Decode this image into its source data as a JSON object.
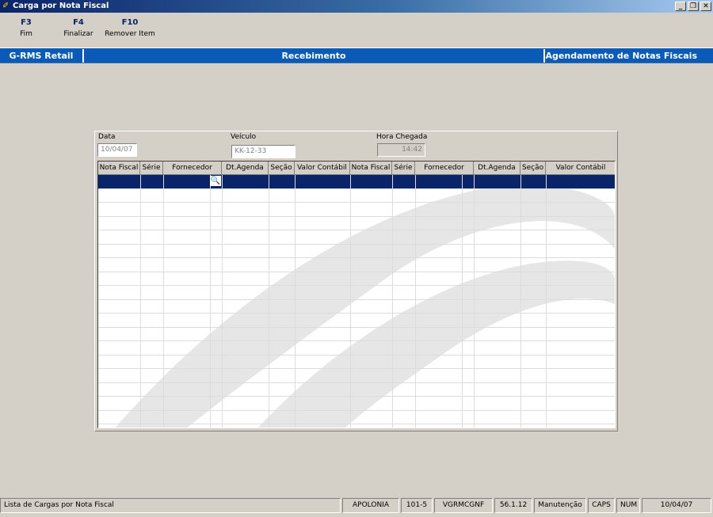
{
  "window": {
    "title": "Carga por Nota Fiscal",
    "icon": "app-icon"
  },
  "fkeys": [
    {
      "key": "F3",
      "label": "Fim"
    },
    {
      "key": "F4",
      "label": "Finalizar"
    },
    {
      "key": "F10",
      "label": "Remover Item"
    }
  ],
  "band": {
    "left": "G-RMS Retail",
    "center": "Recebimento",
    "right": "Agendamento de Notas Fiscais"
  },
  "form": {
    "data_label": "Data",
    "data_value": "10/04/07",
    "veiculo_label": "Veículo",
    "veiculo_value": "KK-12-33",
    "hora_label": "Hora Chegada",
    "hora_value": "14:42"
  },
  "grid": {
    "columns": [
      "Nota Fiscal",
      "Série",
      "Fornecedor",
      "Dt.Agenda",
      "Seção",
      "Valor Contábil",
      "Nota Fiscal",
      "Série",
      "Fornecedor",
      "Dt.Agenda",
      "Seção",
      "Valor Contábil"
    ],
    "selected_row": 0
  },
  "status": {
    "message": "Lista de Cargas por Nota Fiscal",
    "user": "APOLONIA",
    "code": "101-5",
    "program": "VGRMCGNF",
    "version": "56.1.12",
    "mode": "Manutenção",
    "caps": "CAPS",
    "num": "NUM",
    "date": "10/04/07"
  },
  "colors": {
    "title_bar": "#0a246a",
    "band": "#0a5bb8",
    "selection": "#0a246a",
    "face": "#d4d0c8"
  }
}
